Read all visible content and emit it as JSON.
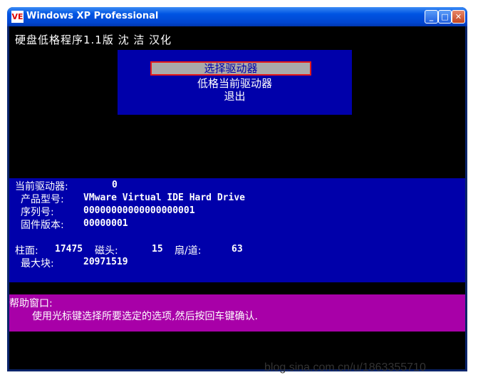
{
  "window": {
    "title": "Windows XP Professional",
    "icon_text": "VE"
  },
  "titlebar_buttons": {
    "minimize": "_",
    "maximize": "□",
    "close": "✕"
  },
  "heading": "硬盘低格程序1.1版 沈 洁 汉化",
  "menu": {
    "items": [
      "选择驱动器",
      "低格当前驱动器",
      "退出"
    ],
    "selected_index": 0
  },
  "drive_info": {
    "current_label": "当前驱动器:",
    "current_value": "0",
    "model_label": "产品型号:",
    "model_value": "VMware Virtual IDE Hard Drive",
    "serial_label": "序列号:",
    "serial_value": "00000000000000000001",
    "firmware_label": "固件版本:",
    "firmware_value": "00000001",
    "cylinders_label": "柱面:",
    "cylinders_value": "17475",
    "heads_label": "磁头:",
    "heads_value": "15",
    "sectors_label": "扇/道:",
    "sectors_value": "63",
    "maxblock_label": "最大块:",
    "maxblock_value": "20971519"
  },
  "help": {
    "title": "帮助窗口:",
    "text": "使用光标键选择所要选定的选项,然后按回车键确认."
  },
  "watermark": "blog.sina.com.cn/u/1863355710"
}
